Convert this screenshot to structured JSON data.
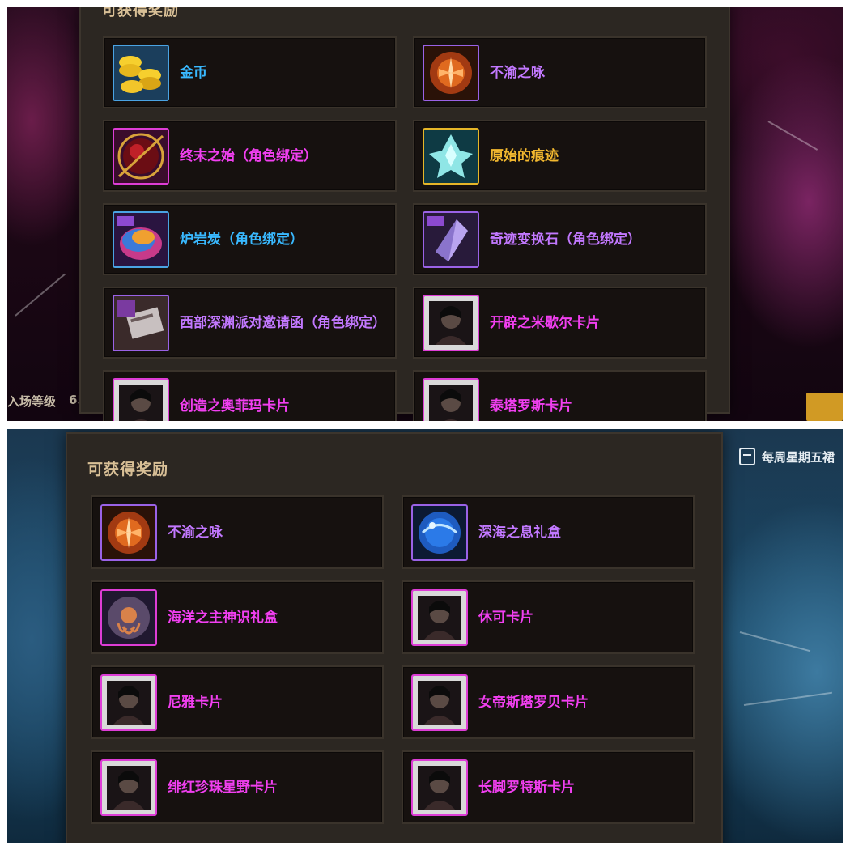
{
  "top_panel": {
    "title": "可获得奖励",
    "rewards": [
      {
        "label": "金币",
        "color": "blue",
        "icon": "gold-coins-icon"
      },
      {
        "label": "不渝之咏",
        "color": "purple",
        "icon": "crimson-emblem-icon"
      },
      {
        "label": "终末之始（角色绑定）",
        "color": "pink",
        "icon": "red-orb-icon"
      },
      {
        "label": "原始的痕迹",
        "color": "gold",
        "icon": "crystal-shard-icon"
      },
      {
        "label": "炉岩炭（角色绑定）",
        "color": "blue",
        "icon": "rainbow-stone-icon"
      },
      {
        "label": "奇迹变换石（角色绑定）",
        "color": "purple",
        "icon": "violet-crystal-icon"
      },
      {
        "label": "西部深渊派对邀请函（角色绑定）",
        "color": "purple",
        "icon": "invitation-letter-icon"
      },
      {
        "label": "开辟之米歇尔卡片",
        "color": "pink",
        "icon": "character-card-icon"
      },
      {
        "label": "创造之奥菲玛卡片",
        "color": "pink",
        "icon": "character-card-icon"
      },
      {
        "label": "泰塔罗斯卡片",
        "color": "pink",
        "icon": "character-card-icon"
      }
    ],
    "left_edge_text": "入场等级",
    "left_edge_value": "65"
  },
  "bottom_panel": {
    "title": "可获得奖励",
    "weekly_text": "每周星期五裙",
    "rewards": [
      {
        "label": "不渝之咏",
        "color": "purple",
        "icon": "crimson-emblem-icon"
      },
      {
        "label": "深海之息礼盒",
        "color": "purple",
        "icon": "deep-sea-orb-icon"
      },
      {
        "label": "海洋之主神识礼盒",
        "color": "pink",
        "icon": "kraken-orb-icon"
      },
      {
        "label": "休可卡片",
        "color": "pink",
        "icon": "character-card-icon"
      },
      {
        "label": "尼雅卡片",
        "color": "pink",
        "icon": "character-card-icon"
      },
      {
        "label": "女帝斯塔罗贝卡片",
        "color": "pink",
        "icon": "character-card-icon"
      },
      {
        "label": "绯红珍珠星野卡片",
        "color": "pink",
        "icon": "character-card-icon"
      },
      {
        "label": "长脚罗特斯卡片",
        "color": "pink",
        "icon": "character-card-icon"
      }
    ]
  },
  "colors": {
    "blue": "#39b9ff",
    "purple": "#c278ff",
    "pink": "#f13ff0",
    "gold": "#f2b82f",
    "panel_bg": "#2c2722",
    "card_bg": "#16110f",
    "title": "#d8bf96"
  }
}
